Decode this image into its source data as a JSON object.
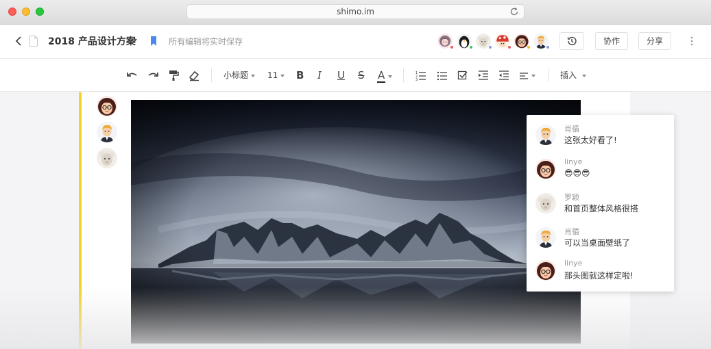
{
  "browser": {
    "url": "shimo.im"
  },
  "header": {
    "doc_title": "2018 产品设计方案",
    "save_status": "所有编辑将实时保存",
    "collaborators": [
      {
        "avatar": "avatar-girl-pink",
        "status_color": "#e85a5a"
      },
      {
        "avatar": "avatar-penguin",
        "status_color": "#3cc15b"
      },
      {
        "avatar": "avatar-sheep",
        "status_color": "#7a9cf0"
      },
      {
        "avatar": "avatar-mushroom",
        "status_color": "#e85a5a"
      },
      {
        "avatar": "avatar-girl-glasses",
        "status_color": "#f0b428"
      },
      {
        "avatar": "avatar-boy-blond",
        "status_color": "#7a9cf0"
      }
    ],
    "collab_label": "协作",
    "share_label": "分享"
  },
  "toolbar": {
    "heading_style": "小标题",
    "font_size": "11",
    "bold": "B",
    "italic": "I",
    "underline": "U",
    "strike": "S",
    "font_color": "A",
    "insert_label": "插入"
  },
  "sidebar_avatars": [
    "avatar-girl-glasses",
    "avatar-boy-blond",
    "avatar-sheep"
  ],
  "comments": [
    {
      "author": "肖循",
      "text": "这张太好看了!",
      "avatar": "avatar-boy-blond"
    },
    {
      "author": "linye",
      "text": "😎😎😎",
      "avatar": "avatar-girl-glasses"
    },
    {
      "author": "罗颖",
      "text": "和首页整体风格很搭",
      "avatar": "avatar-sheep"
    },
    {
      "author": "肖循",
      "text": "可以当桌面壁纸了",
      "avatar": "avatar-boy-blond"
    },
    {
      "author": "linye",
      "text": "那头图就这样定啦!",
      "avatar": "avatar-girl-glasses"
    }
  ],
  "colors": {
    "accent_yellow": "#f5d327",
    "bookmark_blue": "#4a8af0"
  }
}
